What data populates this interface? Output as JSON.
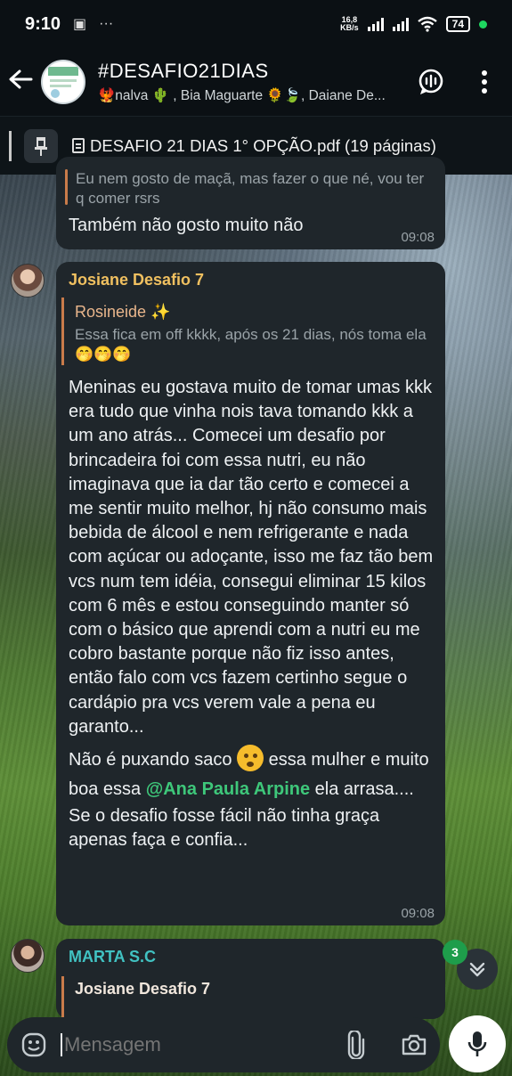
{
  "status_bar": {
    "time": "9:10",
    "net_speed": "16,8",
    "net_unit": "KB/s",
    "battery": "74"
  },
  "header": {
    "title": "#DESAFIO21DIAS",
    "members": "🐦‍🔥nalva 🌵 , Bia Maguarte 🌻🍃, Daiane De..."
  },
  "pinned": {
    "text": "DESAFIO 21 DIAS 1° OPÇÃO.pdf (19 páginas)"
  },
  "messages": [
    {
      "quote_text": "Eu nem gosto de maçã, mas fazer o que né, vou ter q comer rsrs",
      "text": "Também não gosto muito não",
      "time": "09:08"
    },
    {
      "sender": "Josiane Desafio 7",
      "sender_color": "#f0c060",
      "quote_name": "Rosineide ✨",
      "quote_text": "Essa fica em off kkkk, após os 21 dias, nós toma ela 🤭🤭🤭",
      "body_part1": "Meninas eu gostava muito de tomar umas kkk era tudo que vinha nois tava tomando kkk a um ano atrás... Comecei um desafio por brincadeira foi com essa nutri, eu não imaginava que ia dar tão certo e comecei a me sentir muito melhor, hj não consumo mais bebida de álcool e nem refrigerante e nada com açúcar ou adoçante, isso me faz tão bem vcs num tem idéia, consegui eliminar 15 kilos com 6 mês e estou conseguindo manter só com o básico que aprendi com a nutri eu me cobro bastante porque não fiz isso antes, então falo com vcs fazem certinho segue o cardápio pra vcs verem vale a pena eu garanto...",
      "body_part2_a": "Não é puxando saco",
      "body_part2_b": "essa mulher e muito boa essa",
      "mention": "@Ana Paula Arpine",
      "body_part2_c": "ela arrasa....",
      "body_part3": "Se o desafio fosse fácil não tinha graça apenas faça e confia...",
      "time": "09:08"
    },
    {
      "sender": "MARTA S.C",
      "quote_name": "Josiane Desafio 7"
    }
  ],
  "unread_count": "3",
  "composer": {
    "placeholder": "Mensagem"
  },
  "icons": [
    "back-arrow-icon",
    "voice-chat-icon",
    "more-vertical-icon",
    "pin-icon",
    "document-icon",
    "emoji-icon",
    "attach-icon",
    "camera-icon",
    "mic-icon",
    "chevron-down-icon"
  ]
}
